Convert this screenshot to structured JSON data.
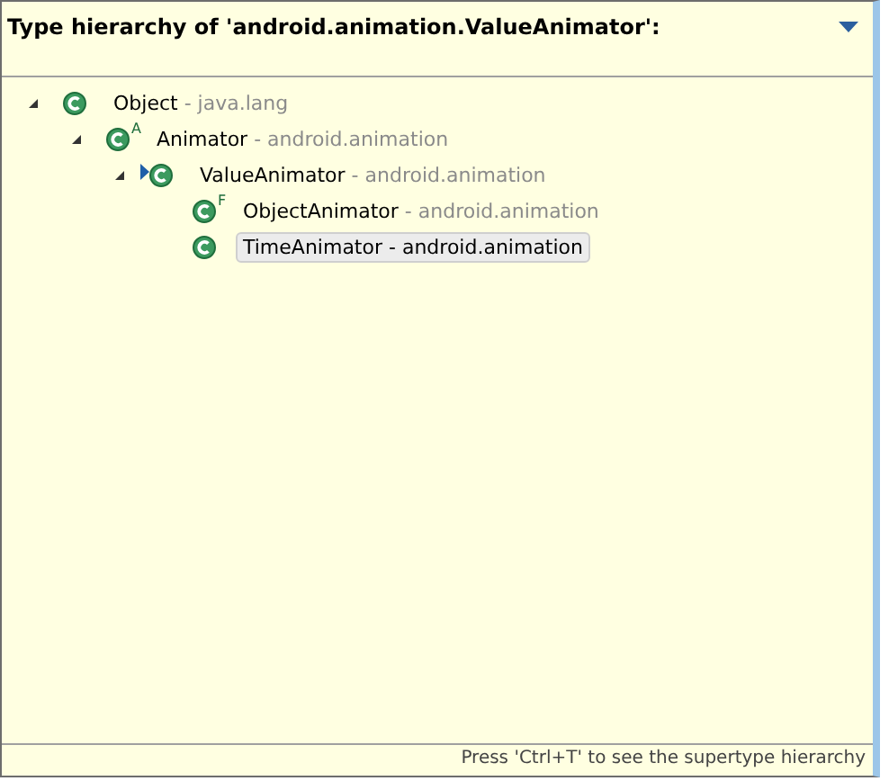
{
  "header": {
    "title": "Type hierarchy of 'android.animation.ValueAnimator':"
  },
  "tree": [
    {
      "name": "Object",
      "package": "- java.lang",
      "expanded": true,
      "selected": false,
      "focus": false,
      "children": [
        {
          "name": "Animator",
          "package": "- android.animation",
          "modifier": "A",
          "expanded": true,
          "selected": false,
          "focus": false,
          "children": [
            {
              "name": "ValueAnimator",
              "package": "- android.animation",
              "expanded": true,
              "selected": false,
              "focus": true,
              "children": [
                {
                  "name": "ObjectAnimator",
                  "package": "- android.animation",
                  "modifier": "F",
                  "selected": false,
                  "focus": false
                },
                {
                  "name": "TimeAnimator",
                  "package": "- android.animation",
                  "selected": true,
                  "focus": false
                }
              ]
            }
          ]
        }
      ]
    }
  ],
  "status_bar": "Press 'Ctrl+T' to see the supertype hierarchy"
}
